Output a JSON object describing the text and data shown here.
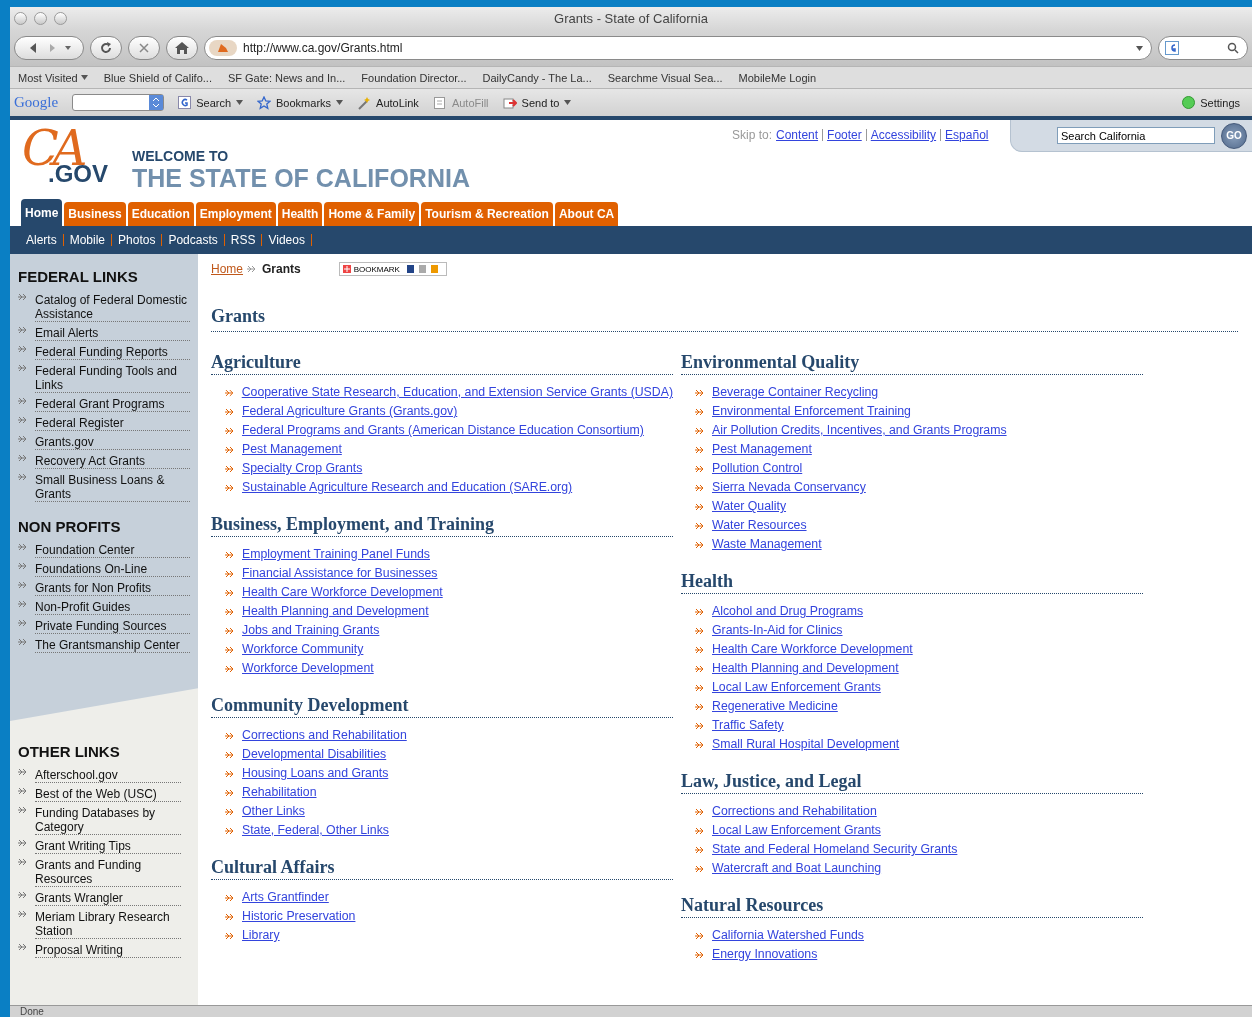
{
  "window": {
    "title": "Grants - State of California"
  },
  "navigation": {
    "url": "http://www.ca.gov/Grants.html"
  },
  "bookmarks_bar": [
    {
      "label": "Most Visited",
      "menu": true
    },
    {
      "label": "Blue Shield of Califo...",
      "menu": false
    },
    {
      "label": "SF Gate: News and In...",
      "menu": false
    },
    {
      "label": "Foundation Director...",
      "menu": false
    },
    {
      "label": "DailyCandy - The La...",
      "menu": false
    },
    {
      "label": "Searchme Visual Sea...",
      "menu": false
    },
    {
      "label": "MobileMe Login",
      "menu": false
    }
  ],
  "google_toolbar": {
    "logo": "Google",
    "items": [
      {
        "label": "Search",
        "kind": "search",
        "disabled": false,
        "menu": true
      },
      {
        "label": "Bookmarks",
        "kind": "bookmarks",
        "disabled": false,
        "menu": true
      },
      {
        "label": "AutoLink",
        "kind": "autolink",
        "disabled": false,
        "menu": false
      },
      {
        "label": "AutoFill",
        "kind": "autofill",
        "disabled": true,
        "menu": false
      },
      {
        "label": "Send to",
        "kind": "send",
        "disabled": false,
        "menu": true
      }
    ],
    "settings": "Settings"
  },
  "header": {
    "logo_letters": "CA",
    "logo_suffix": ".GOV",
    "welcome": "WELCOME TO",
    "title": "THE STATE OF CALIFORNIA",
    "skip_label": "Skip to:",
    "skip_links": [
      "Content",
      "Footer",
      "Accessibility",
      "Español"
    ],
    "search_value": "Search California",
    "search_button": "GO"
  },
  "tabs": [
    {
      "label": "Home",
      "selected": true
    },
    {
      "label": "Business",
      "selected": false
    },
    {
      "label": "Education",
      "selected": false
    },
    {
      "label": "Employment",
      "selected": false
    },
    {
      "label": "Health",
      "selected": false
    },
    {
      "label": "Home & Family",
      "selected": false
    },
    {
      "label": "Tourism & Recreation",
      "selected": false
    },
    {
      "label": "About CA",
      "selected": false
    }
  ],
  "subnav": [
    "Alerts",
    "Mobile",
    "Photos",
    "Podcasts",
    "RSS",
    "Videos"
  ],
  "sidebar": [
    {
      "title": "FEDERAL LINKS",
      "shaded": true,
      "items": [
        "Catalog of Federal Domestic Assistance",
        "Email Alerts",
        "Federal Funding Reports",
        "Federal Funding Tools and Links",
        "Federal Grant Programs",
        "Federal Register",
        "Grants.gov",
        "Recovery Act Grants",
        "Small Business Loans & Grants"
      ]
    },
    {
      "title": "NON PROFITS",
      "shaded": true,
      "items": [
        "Foundation Center",
        "Foundations On-Line",
        "Grants for Non Profits",
        "Non-Profit Guides",
        "Private Funding Sources",
        "The Grantsmanship Center"
      ]
    },
    {
      "title": "OTHER LINKS",
      "shaded": false,
      "items": [
        "Afterschool.gov",
        "Best of the Web (USC)",
        "Funding Databases by Category",
        "Grant Writing Tips",
        "Grants and Funding Resources",
        "Grants Wrangler",
        "Meriam Library Research Station",
        "Proposal Writing"
      ]
    }
  ],
  "breadcrumb": {
    "home": "Home",
    "current": "Grants",
    "bookmark": "BOOKMARK"
  },
  "page_title": "Grants",
  "columns": [
    [
      {
        "title": "Agriculture",
        "links": [
          "Cooperative State Research, Education, and Extension Service Grants (USDA)",
          "Federal Agriculture Grants (Grants.gov)",
          "Federal Programs and Grants (American Distance Education Consortium)",
          "Pest Management",
          "Specialty Crop Grants",
          "Sustainable Agriculture Research and Education (SARE.org)"
        ]
      },
      {
        "title": "Business, Employment, and Training",
        "links": [
          "Employment Training Panel Funds",
          "Financial Assistance for Businesses",
          "Health Care Workforce Development",
          "Health Planning and Development",
          "Jobs and Training Grants",
          "Workforce Community",
          "Workforce Development"
        ]
      },
      {
        "title": "Community Development",
        "links": [
          "Corrections and Rehabilitation",
          "Developmental Disabilities",
          "Housing Loans and Grants",
          "Rehabilitation",
          "Other Links",
          "State, Federal, Other Links"
        ]
      },
      {
        "title": "Cultural Affairs",
        "links": [
          "Arts Grantfinder",
          "Historic Preservation",
          "Library"
        ]
      }
    ],
    [
      {
        "title": "Environmental Quality",
        "links": [
          "Beverage Container Recycling",
          "Environmental Enforcement Training",
          "Air Pollution Credits, Incentives, and Grants Programs",
          "Pest Management",
          "Pollution Control",
          "Sierra Nevada Conservancy",
          "Water Quality",
          "Water Resources",
          "Waste Management"
        ]
      },
      {
        "title": "Health",
        "links": [
          "Alcohol and Drug Programs",
          "Grants-In-Aid for Clinics",
          "Health Care Workforce Development",
          "Health Planning and Development",
          "Local Law Enforcement Grants",
          "Regenerative Medicine",
          "Traffic Safety",
          "Small Rural Hospital Development"
        ]
      },
      {
        "title": "Law, Justice, and Legal",
        "links": [
          "Corrections and Rehabilitation",
          "Local Law Enforcement Grants",
          "State and Federal Homeland Security Grants",
          "Watercraft and Boat Launching"
        ]
      },
      {
        "title": "Natural Resources",
        "links": [
          "California Watershed Funds",
          "Energy Innovations"
        ]
      }
    ]
  ],
  "status_bar": "Done"
}
